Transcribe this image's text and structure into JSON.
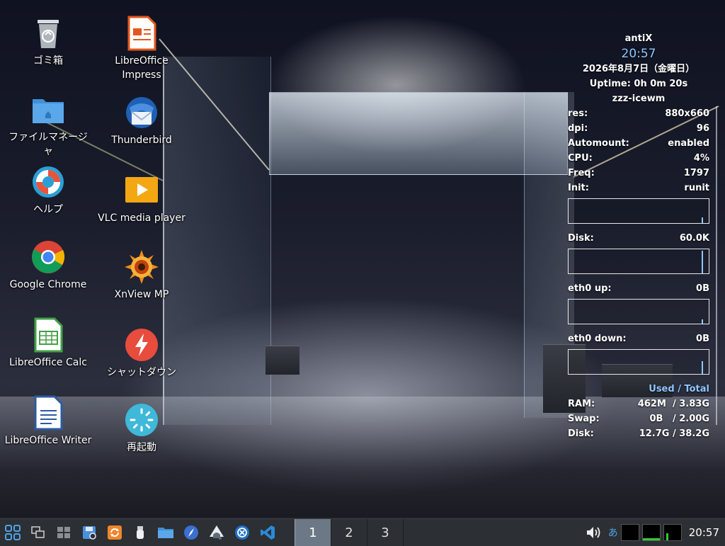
{
  "desktop": {
    "icons": [
      {
        "label": "ゴミ箱"
      },
      {
        "label": "ファイルマネージャ"
      },
      {
        "label": "ヘルプ"
      },
      {
        "label": "Google Chrome"
      },
      {
        "label": "LibreOffice Calc"
      },
      {
        "label": "LibreOffice Writer"
      },
      {
        "label": "LibreOffice Impress"
      },
      {
        "label": "Thunderbird"
      },
      {
        "label": "VLC media player"
      },
      {
        "label": "XnView MP"
      },
      {
        "label": "シャットダウン"
      },
      {
        "label": "再起動"
      }
    ]
  },
  "conky": {
    "hostname": "antiX",
    "time": "20:57",
    "date": "2026年8月7日（金曜日）",
    "uptime": "Uptime: 0h 0m 20s",
    "session": "zzz-icewm",
    "stats": [
      {
        "label": "res:",
        "value": "880x660"
      },
      {
        "label": "dpi:",
        "value": "96"
      },
      {
        "label": "Automount:",
        "value": "enabled"
      },
      {
        "label": "CPU:",
        "value": "4%"
      },
      {
        "label": "Freq:",
        "value": "1797"
      },
      {
        "label": "Init:",
        "value": "runit"
      }
    ],
    "disk": {
      "label": "Disk:",
      "value": "60.0K"
    },
    "eth_up": {
      "label": "eth0 up:",
      "value": "0B"
    },
    "eth_down": {
      "label": "eth0 down:",
      "value": "0B"
    },
    "mem_header": "Used / Total",
    "mem": [
      {
        "label": "RAM:",
        "value": "462M  / 3.83G"
      },
      {
        "label": "Swap:",
        "value": "0B   / 2.00G"
      },
      {
        "label": "Disk:",
        "value": "12.7G / 38.2G"
      }
    ],
    "accent_color": "#8fc6ff"
  },
  "taskbar": {
    "workspaces": [
      "1",
      "2",
      "3"
    ],
    "active_workspace": "1",
    "ime_label": "あ",
    "clock": "20:57",
    "launchers": [
      "menu-icon",
      "window-list-icon",
      "show-desktop-icon",
      "save-icon",
      "update-icon",
      "usb-icon",
      "folder-icon",
      "compass-icon",
      "inkscape-icon",
      "network-icon",
      "vscode-icon"
    ]
  }
}
